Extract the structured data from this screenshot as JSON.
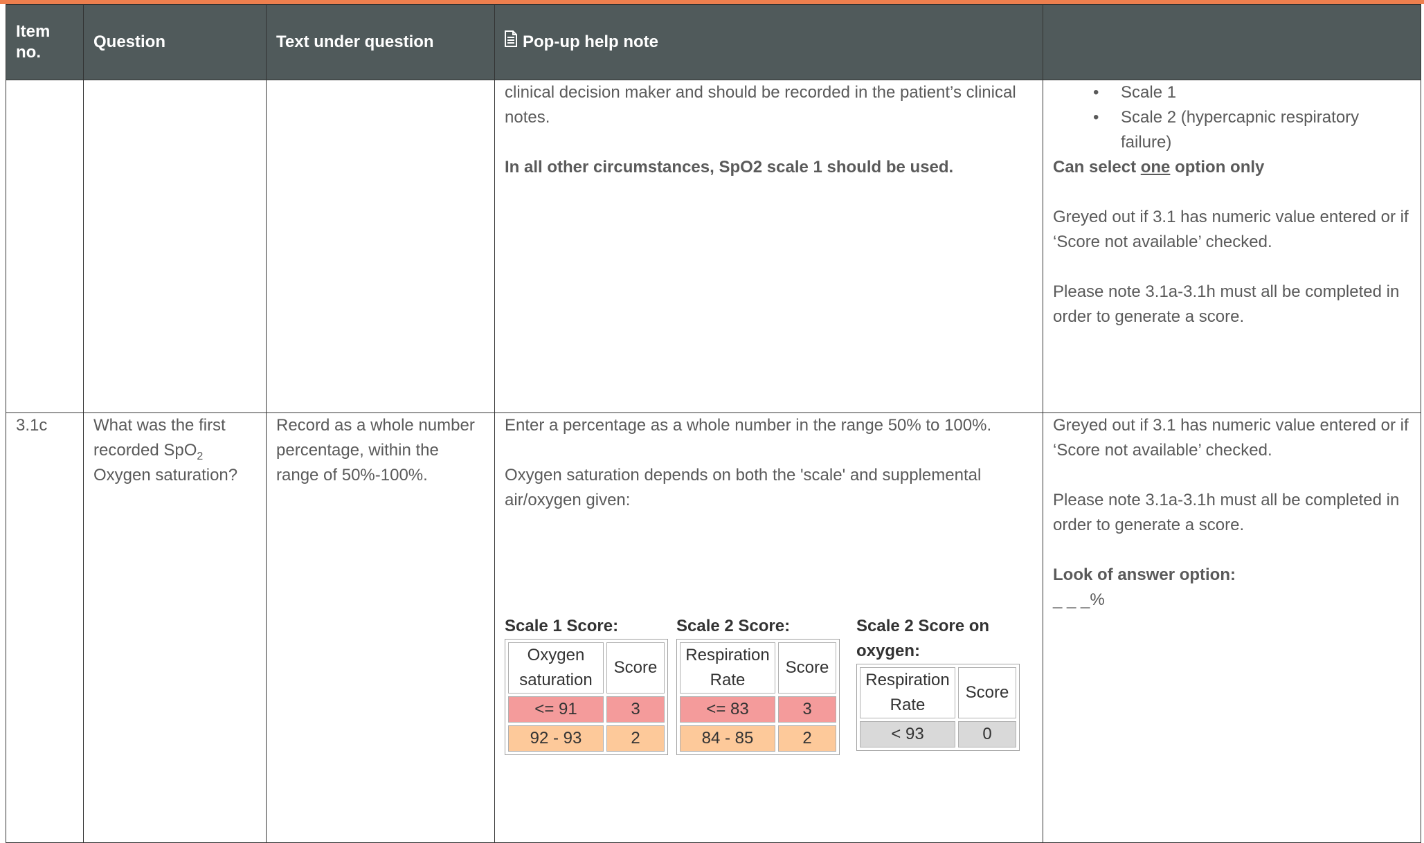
{
  "header": {
    "col_item": "Item no.",
    "col_question": "Question",
    "col_text_under": "Text under question",
    "col_popup": "Pop-up help note",
    "col_last": ""
  },
  "row1": {
    "popup_para1": "clinical decision maker and should be recorded in the patient’s clinical notes.",
    "popup_para2": "In all other circumstances, SpO2 scale 1 should be used.",
    "options": [
      "Scale 1",
      "Scale 2 (hypercapnic respiratory failure)"
    ],
    "select_prefix": "Can select ",
    "select_underlined": "one",
    "select_suffix": " option only",
    "greyed_note": "Greyed out if 3.1 has numeric value entered or if ‘Score not available’ checked.",
    "please_note": "Please note 3.1a-3.1h must all be completed in order to generate a score."
  },
  "row2": {
    "item_no": "3.1c",
    "question_prefix": "What was the first recorded SpO",
    "question_sub": "2",
    "question_suffix": " Oxygen saturation?",
    "text_under": "Record as a whole number percentage, within the range of 50%-100%.",
    "popup_para1": "Enter a percentage as a whole number in the range 50% to 100%.",
    "popup_para2": "Oxygen saturation depends on both the 'scale' and supplemental air/oxygen given:",
    "scale1_title": "Scale 1 Score:",
    "scale2_title": "Scale 2 Score:",
    "scale2o_title": "Scale 2 Score on oxygen:",
    "scale1_table": {
      "headers": [
        "Oxygen saturation",
        "Score"
      ],
      "rows": [
        [
          "<= 91",
          "3"
        ],
        [
          "92 - 93",
          "2"
        ]
      ]
    },
    "scale2_table": {
      "headers": [
        "Respiration Rate",
        "Score"
      ],
      "rows": [
        [
          "<= 83",
          "3"
        ],
        [
          "84 - 85",
          "2"
        ]
      ]
    },
    "scale2o_table": {
      "headers": [
        "Respiration Rate",
        "Score"
      ],
      "rows": [
        [
          "< 93",
          "0"
        ]
      ]
    },
    "greyed_note": "Greyed out if 3.1 has numeric value entered or if ‘Score not available’ checked.",
    "please_note": "Please note 3.1a-3.1h must all be completed in order to generate a score.",
    "look_label": "Look of answer option:",
    "look_value": "_ _ _%"
  },
  "colors": {
    "header_bg": "#505a5b",
    "accent_bar": "#ee7f4e",
    "score3": "#f49b9b",
    "score2": "#fdc99a",
    "score0": "#d9d9d9"
  }
}
